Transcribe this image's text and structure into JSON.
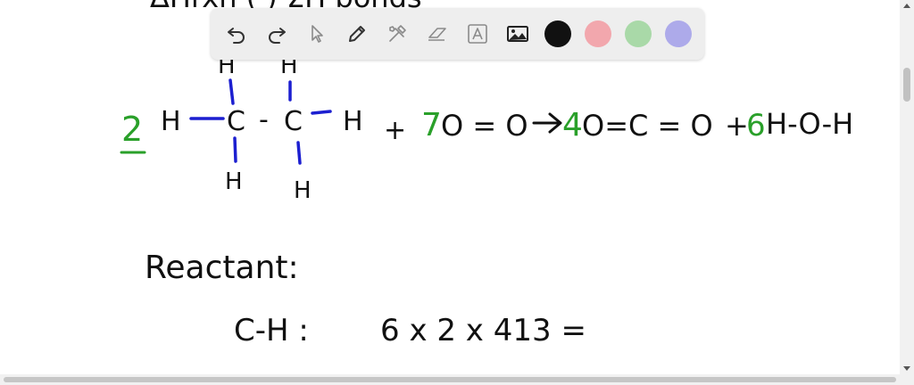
{
  "toolbar": {
    "tools": [
      {
        "name": "undo-icon"
      },
      {
        "name": "redo-icon"
      },
      {
        "name": "pointer-icon"
      },
      {
        "name": "pen-icon"
      },
      {
        "name": "tools-icon"
      },
      {
        "name": "eraser-icon"
      },
      {
        "name": "text-icon"
      },
      {
        "name": "image-icon"
      }
    ],
    "colors": [
      "#111111",
      "#f2a7ad",
      "#a9d9a8",
      "#adaaea"
    ]
  },
  "ink_colors": {
    "black": "#111111",
    "blue": "#1c1fd0",
    "green": "#2aa02a"
  },
  "whiteboard": {
    "top_partial": "ΔHrxn (           ) ΣH bonds",
    "equation": {
      "coef_ethane": "2",
      "ethane_left_h": "H",
      "ethane_c1": "C",
      "ethane_dash": "-",
      "ethane_c2": "C",
      "ethane_right_h": "H",
      "ethane_top_h": "H",
      "ethane_bottom_h1": "H",
      "ethane_bottom_h2": "H",
      "plus1": "+",
      "coef_o2": "7",
      "o2": "O = O",
      "coef_co2": "4",
      "co2": "O=C = O",
      "plus2": "+",
      "coef_water": "6",
      "water": "H-O-H"
    },
    "reactant_label": "Reactant:",
    "calc_label": "C-H :",
    "calc_expr": "6 x 2 x  413 ="
  }
}
